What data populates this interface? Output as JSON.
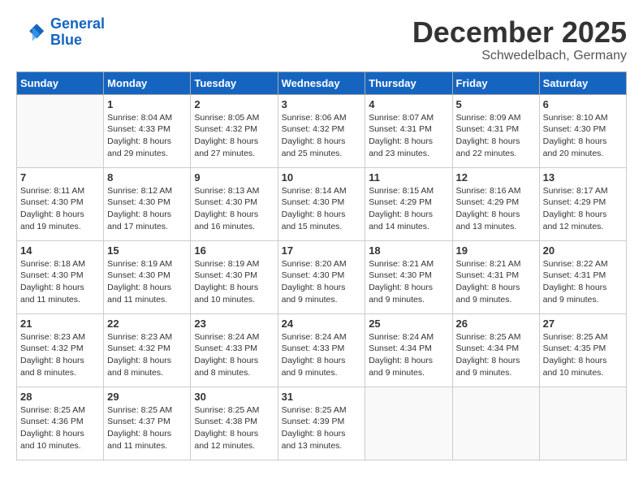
{
  "header": {
    "logo_line1": "General",
    "logo_line2": "Blue",
    "month_title": "December 2025",
    "location": "Schwedelbach, Germany"
  },
  "days_of_week": [
    "Sunday",
    "Monday",
    "Tuesday",
    "Wednesday",
    "Thursday",
    "Friday",
    "Saturday"
  ],
  "weeks": [
    [
      {
        "day": null
      },
      {
        "day": 1,
        "sunrise": "Sunrise: 8:04 AM",
        "sunset": "Sunset: 4:33 PM",
        "daylight": "Daylight: 8 hours and 29 minutes."
      },
      {
        "day": 2,
        "sunrise": "Sunrise: 8:05 AM",
        "sunset": "Sunset: 4:32 PM",
        "daylight": "Daylight: 8 hours and 27 minutes."
      },
      {
        "day": 3,
        "sunrise": "Sunrise: 8:06 AM",
        "sunset": "Sunset: 4:32 PM",
        "daylight": "Daylight: 8 hours and 25 minutes."
      },
      {
        "day": 4,
        "sunrise": "Sunrise: 8:07 AM",
        "sunset": "Sunset: 4:31 PM",
        "daylight": "Daylight: 8 hours and 23 minutes."
      },
      {
        "day": 5,
        "sunrise": "Sunrise: 8:09 AM",
        "sunset": "Sunset: 4:31 PM",
        "daylight": "Daylight: 8 hours and 22 minutes."
      },
      {
        "day": 6,
        "sunrise": "Sunrise: 8:10 AM",
        "sunset": "Sunset: 4:30 PM",
        "daylight": "Daylight: 8 hours and 20 minutes."
      }
    ],
    [
      {
        "day": 7,
        "sunrise": "Sunrise: 8:11 AM",
        "sunset": "Sunset: 4:30 PM",
        "daylight": "Daylight: 8 hours and 19 minutes."
      },
      {
        "day": 8,
        "sunrise": "Sunrise: 8:12 AM",
        "sunset": "Sunset: 4:30 PM",
        "daylight": "Daylight: 8 hours and 17 minutes."
      },
      {
        "day": 9,
        "sunrise": "Sunrise: 8:13 AM",
        "sunset": "Sunset: 4:30 PM",
        "daylight": "Daylight: 8 hours and 16 minutes."
      },
      {
        "day": 10,
        "sunrise": "Sunrise: 8:14 AM",
        "sunset": "Sunset: 4:30 PM",
        "daylight": "Daylight: 8 hours and 15 minutes."
      },
      {
        "day": 11,
        "sunrise": "Sunrise: 8:15 AM",
        "sunset": "Sunset: 4:29 PM",
        "daylight": "Daylight: 8 hours and 14 minutes."
      },
      {
        "day": 12,
        "sunrise": "Sunrise: 8:16 AM",
        "sunset": "Sunset: 4:29 PM",
        "daylight": "Daylight: 8 hours and 13 minutes."
      },
      {
        "day": 13,
        "sunrise": "Sunrise: 8:17 AM",
        "sunset": "Sunset: 4:29 PM",
        "daylight": "Daylight: 8 hours and 12 minutes."
      }
    ],
    [
      {
        "day": 14,
        "sunrise": "Sunrise: 8:18 AM",
        "sunset": "Sunset: 4:30 PM",
        "daylight": "Daylight: 8 hours and 11 minutes."
      },
      {
        "day": 15,
        "sunrise": "Sunrise: 8:19 AM",
        "sunset": "Sunset: 4:30 PM",
        "daylight": "Daylight: 8 hours and 11 minutes."
      },
      {
        "day": 16,
        "sunrise": "Sunrise: 8:19 AM",
        "sunset": "Sunset: 4:30 PM",
        "daylight": "Daylight: 8 hours and 10 minutes."
      },
      {
        "day": 17,
        "sunrise": "Sunrise: 8:20 AM",
        "sunset": "Sunset: 4:30 PM",
        "daylight": "Daylight: 8 hours and 9 minutes."
      },
      {
        "day": 18,
        "sunrise": "Sunrise: 8:21 AM",
        "sunset": "Sunset: 4:30 PM",
        "daylight": "Daylight: 8 hours and 9 minutes."
      },
      {
        "day": 19,
        "sunrise": "Sunrise: 8:21 AM",
        "sunset": "Sunset: 4:31 PM",
        "daylight": "Daylight: 8 hours and 9 minutes."
      },
      {
        "day": 20,
        "sunrise": "Sunrise: 8:22 AM",
        "sunset": "Sunset: 4:31 PM",
        "daylight": "Daylight: 8 hours and 9 minutes."
      }
    ],
    [
      {
        "day": 21,
        "sunrise": "Sunrise: 8:23 AM",
        "sunset": "Sunset: 4:32 PM",
        "daylight": "Daylight: 8 hours and 8 minutes."
      },
      {
        "day": 22,
        "sunrise": "Sunrise: 8:23 AM",
        "sunset": "Sunset: 4:32 PM",
        "daylight": "Daylight: 8 hours and 8 minutes."
      },
      {
        "day": 23,
        "sunrise": "Sunrise: 8:24 AM",
        "sunset": "Sunset: 4:33 PM",
        "daylight": "Daylight: 8 hours and 8 minutes."
      },
      {
        "day": 24,
        "sunrise": "Sunrise: 8:24 AM",
        "sunset": "Sunset: 4:33 PM",
        "daylight": "Daylight: 8 hours and 9 minutes."
      },
      {
        "day": 25,
        "sunrise": "Sunrise: 8:24 AM",
        "sunset": "Sunset: 4:34 PM",
        "daylight": "Daylight: 8 hours and 9 minutes."
      },
      {
        "day": 26,
        "sunrise": "Sunrise: 8:25 AM",
        "sunset": "Sunset: 4:34 PM",
        "daylight": "Daylight: 8 hours and 9 minutes."
      },
      {
        "day": 27,
        "sunrise": "Sunrise: 8:25 AM",
        "sunset": "Sunset: 4:35 PM",
        "daylight": "Daylight: 8 hours and 10 minutes."
      }
    ],
    [
      {
        "day": 28,
        "sunrise": "Sunrise: 8:25 AM",
        "sunset": "Sunset: 4:36 PM",
        "daylight": "Daylight: 8 hours and 10 minutes."
      },
      {
        "day": 29,
        "sunrise": "Sunrise: 8:25 AM",
        "sunset": "Sunset: 4:37 PM",
        "daylight": "Daylight: 8 hours and 11 minutes."
      },
      {
        "day": 30,
        "sunrise": "Sunrise: 8:25 AM",
        "sunset": "Sunset: 4:38 PM",
        "daylight": "Daylight: 8 hours and 12 minutes."
      },
      {
        "day": 31,
        "sunrise": "Sunrise: 8:25 AM",
        "sunset": "Sunset: 4:39 PM",
        "daylight": "Daylight: 8 hours and 13 minutes."
      },
      {
        "day": null
      },
      {
        "day": null
      },
      {
        "day": null
      }
    ]
  ]
}
